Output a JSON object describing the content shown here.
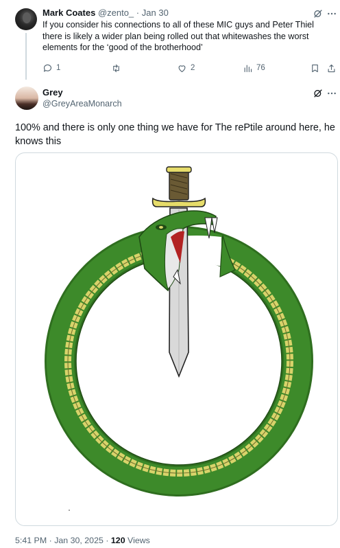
{
  "reply": {
    "author_name": "Mark Coates",
    "handle": "@zento_",
    "separator": "·",
    "date": "Jan 30",
    "text": "If you consider his connections to all of these MIC guys and Peter Thiel there is likely a wider plan being rolled out that whitewashes the worst elements for the ‘good of the brotherhood’",
    "actions": {
      "replies": "1",
      "reposts": "",
      "likes": "2",
      "views": "76"
    }
  },
  "post": {
    "author_name": "Grey",
    "handle": "@GreyAreaMonarch",
    "text": "100% and there is only one thing we have for The rePtile around here, he knows this",
    "media_icons": {
      "image": "ouroboros-serpent-dagger"
    },
    "meta": {
      "time": "5:41 PM",
      "separator": "·",
      "date": "Jan 30, 2025",
      "separator2": "·",
      "views_count": "120",
      "views_label": "Views"
    }
  },
  "colors": {
    "text": "#0f1419",
    "muted": "#536471",
    "border": "#cfd9de",
    "serpent_green": "#3d8a2a",
    "serpent_yellow": "#d8d36a"
  }
}
